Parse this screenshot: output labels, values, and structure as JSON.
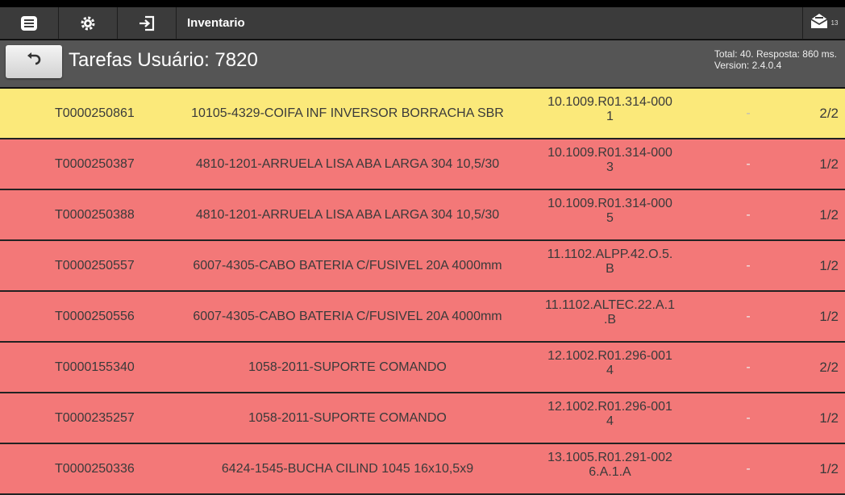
{
  "toolbar": {
    "app_title": "Inventario",
    "mail_count": "13",
    "icons": [
      "menu-icon",
      "gear-icon",
      "login-icon",
      "mail-icon"
    ]
  },
  "header": {
    "title": "Tarefas Usuário: 7820",
    "status_line1": "Total: 40. Resposta: 860 ms.",
    "status_line2": "Version: 2.4.0.4"
  },
  "colors": {
    "pending": "#f37878",
    "selected": "#fbe97a",
    "toolbar": "#3b3b3b",
    "subheader": "#555555"
  },
  "tasks": [
    {
      "id": "T0000250861",
      "desc": "10105-4329-COIFA INF INVERSOR BORRACHA SBR",
      "loc1": "10.1009.R01.314-000",
      "loc2": "1",
      "mark": "-",
      "qty": "2/2",
      "state": "selected"
    },
    {
      "id": "T0000250387",
      "desc": "4810-1201-ARRUELA LISA ABA LARGA 304 10,5/30",
      "loc1": "10.1009.R01.314-000",
      "loc2": "3",
      "mark": "-",
      "qty": "1/2",
      "state": "pending"
    },
    {
      "id": "T0000250388",
      "desc": "4810-1201-ARRUELA LISA ABA LARGA 304 10,5/30",
      "loc1": "10.1009.R01.314-000",
      "loc2": "5",
      "mark": "-",
      "qty": "1/2",
      "state": "pending"
    },
    {
      "id": "T0000250557",
      "desc": "6007-4305-CABO BATERIA C/FUSIVEL 20A 4000mm",
      "loc1": "11.1102.ALPP.42.O.5.",
      "loc2": "B",
      "mark": "-",
      "qty": "1/2",
      "state": "pending"
    },
    {
      "id": "T0000250556",
      "desc": "6007-4305-CABO BATERIA C/FUSIVEL 20A 4000mm",
      "loc1": "11.1102.ALTEC.22.A.1",
      "loc2": ".B",
      "mark": "-",
      "qty": "1/2",
      "state": "pending"
    },
    {
      "id": "T0000155340",
      "desc": "1058-2011-SUPORTE COMANDO",
      "loc1": "12.1002.R01.296-001",
      "loc2": "4",
      "mark": "-",
      "qty": "2/2",
      "state": "pending"
    },
    {
      "id": "T0000235257",
      "desc": "1058-2011-SUPORTE COMANDO",
      "loc1": "12.1002.R01.296-001",
      "loc2": "4",
      "mark": "-",
      "qty": "1/2",
      "state": "pending"
    },
    {
      "id": "T0000250336",
      "desc": "6424-1545-BUCHA CILIND 1045 16x10,5x9",
      "loc1": "13.1005.R01.291-002",
      "loc2": "6.A.1.A",
      "mark": "-",
      "qty": "1/2",
      "state": "pending"
    }
  ]
}
